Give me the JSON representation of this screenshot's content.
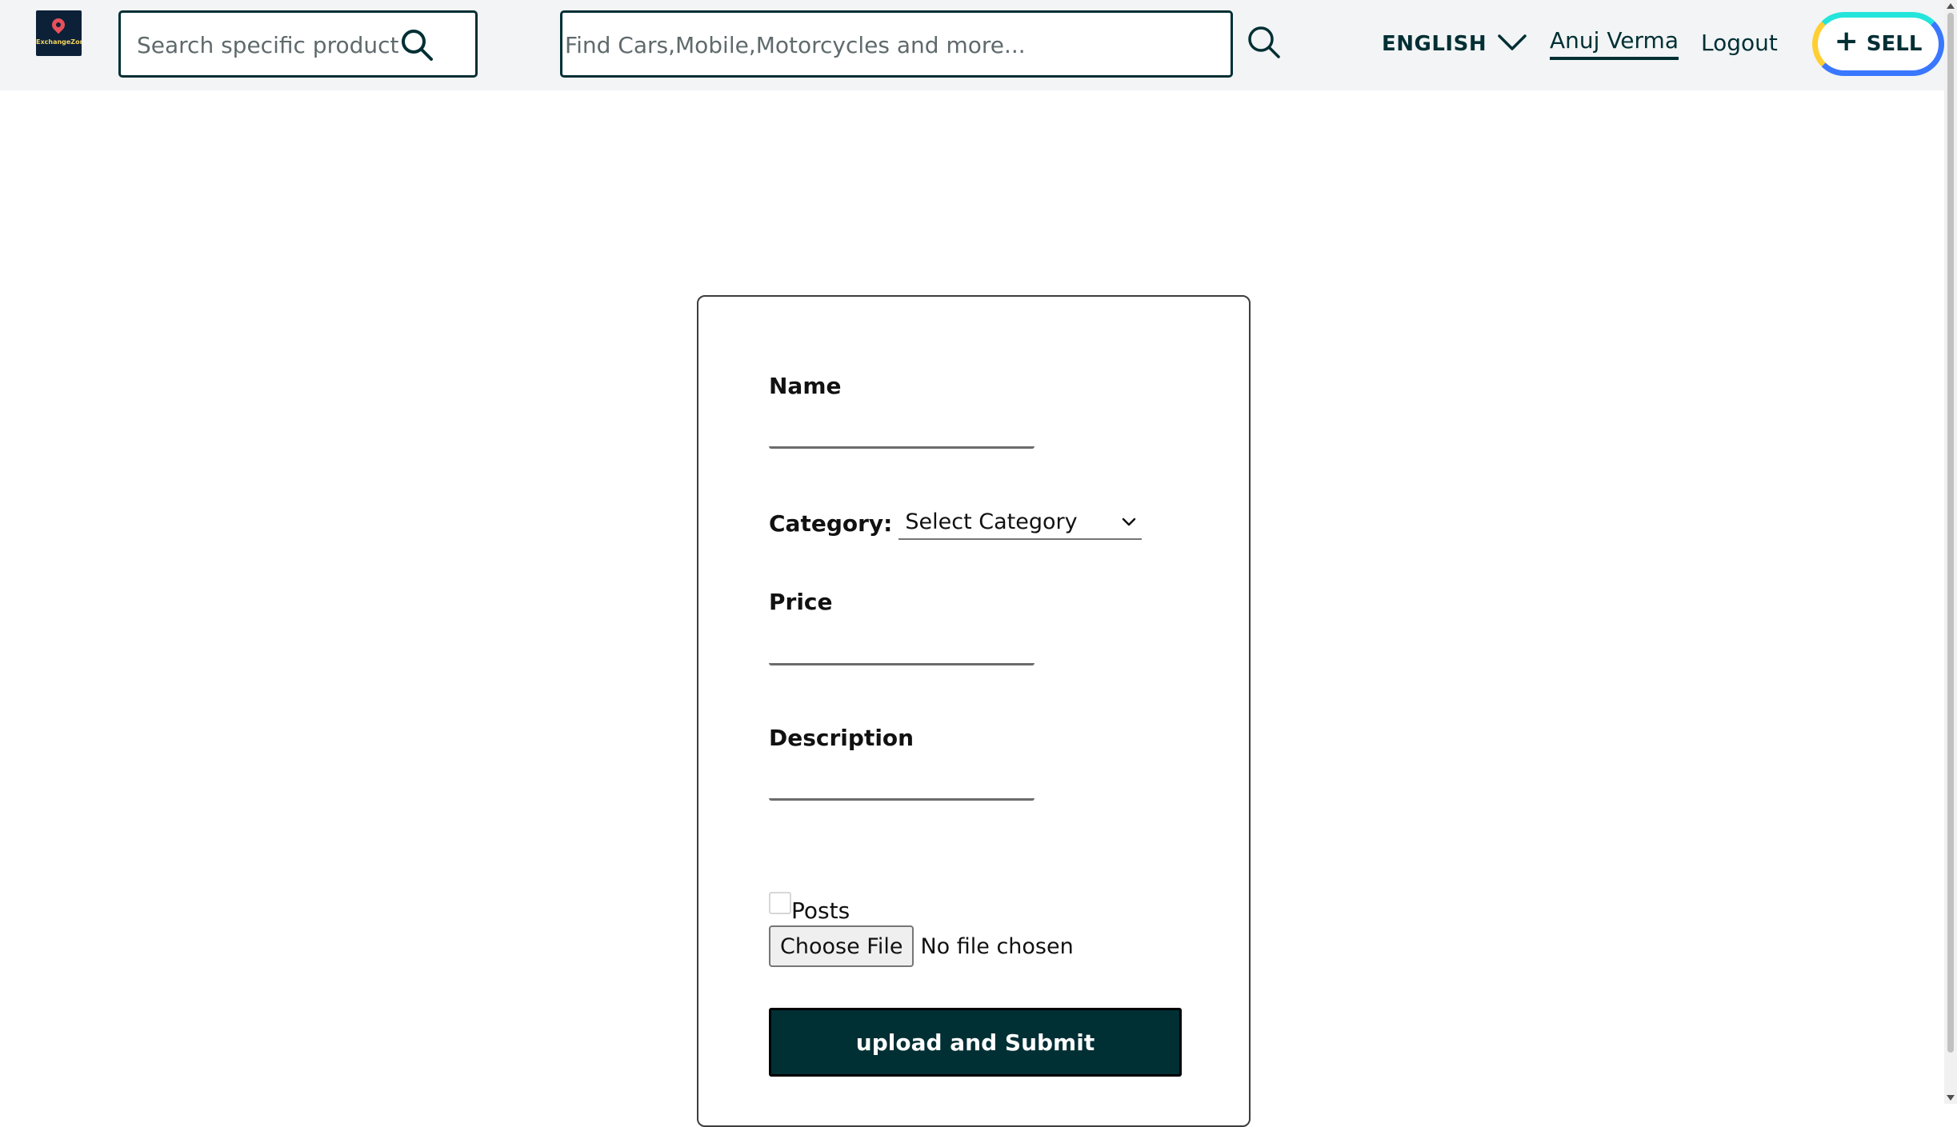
{
  "header": {
    "logo": {
      "text": "ExchangeZone",
      "icon": "map-pin-icon"
    },
    "product_search": {
      "placeholder": "Search specific product...",
      "value": "",
      "icon": "search-icon"
    },
    "main_search": {
      "placeholder": "Find Cars,Mobile,Motorcycles and more...",
      "value": "",
      "icon": "search-icon"
    },
    "language": {
      "label": "ENGLISH",
      "icon": "chevron-down-icon"
    },
    "user_name": "Anuj Verma",
    "logout_label": "Logout",
    "sell": {
      "label": "SELL",
      "icon": "plus-icon",
      "border_colors": [
        "#23e5db",
        "#3a77ff",
        "#ffce32"
      ]
    }
  },
  "form": {
    "name_label": "Name",
    "name_value": "",
    "category_label": "Category:",
    "category_selected": "Select Category",
    "price_label": "Price",
    "price_value": "",
    "description_label": "Description",
    "description_value": "",
    "posts_label": "Posts",
    "posts_checked": false,
    "file_button_label": "Choose File",
    "file_status": "No file chosen",
    "submit_label": "upload and Submit"
  },
  "colors": {
    "brand_dark": "#002f34",
    "header_bg": "#f2f4f5"
  }
}
